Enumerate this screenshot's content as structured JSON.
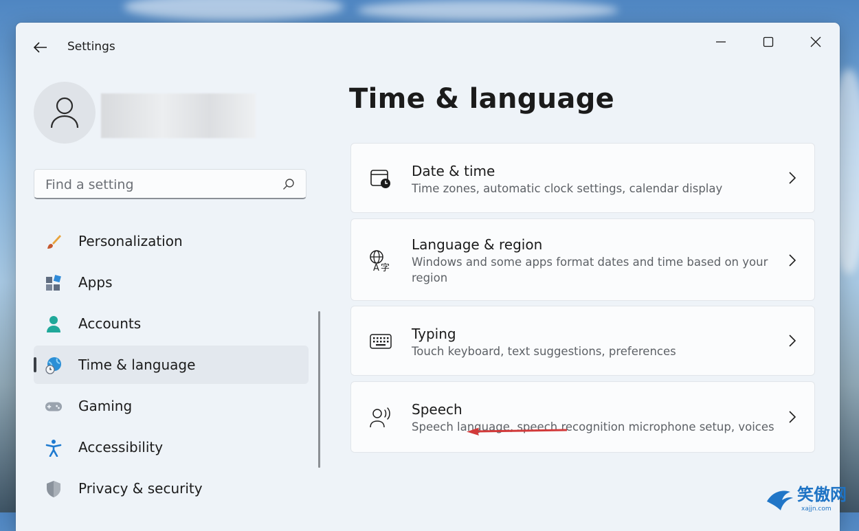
{
  "window": {
    "title": "Settings"
  },
  "user": {
    "name_blurred": ""
  },
  "search": {
    "placeholder": "Find a setting"
  },
  "sidebar": {
    "items": [
      {
        "label": "Personalization",
        "icon": "brush-icon",
        "active": false
      },
      {
        "label": "Apps",
        "icon": "apps-icon",
        "active": false
      },
      {
        "label": "Accounts",
        "icon": "person-icon",
        "active": false
      },
      {
        "label": "Time & language",
        "icon": "globe-clock-icon",
        "active": true
      },
      {
        "label": "Gaming",
        "icon": "gamepad-icon",
        "active": false
      },
      {
        "label": "Accessibility",
        "icon": "accessibility-icon",
        "active": false
      },
      {
        "label": "Privacy & security",
        "icon": "shield-icon",
        "active": false
      }
    ]
  },
  "main": {
    "title": "Time & language",
    "cards": [
      {
        "title": "Date & time",
        "description": "Time zones, automatic clock settings, calendar display",
        "icon": "calendar-clock-icon"
      },
      {
        "title": "Language & region",
        "description": "Windows and some apps format dates and time based on your region",
        "icon": "language-icon"
      },
      {
        "title": "Typing",
        "description": "Touch keyboard, text suggestions, preferences",
        "icon": "keyboard-icon"
      },
      {
        "title": "Speech",
        "description": "Speech language, speech recognition microphone setup, voices",
        "icon": "speech-icon"
      }
    ]
  },
  "annotation": {
    "arrow_color": "#d23a3a"
  },
  "watermark": {
    "text": "笑傲网",
    "subtext": "xajjn.com"
  },
  "colors": {
    "accent": "#0067c0",
    "window_bg": "#eef3f8",
    "card_bg": "#fbfcfd"
  }
}
